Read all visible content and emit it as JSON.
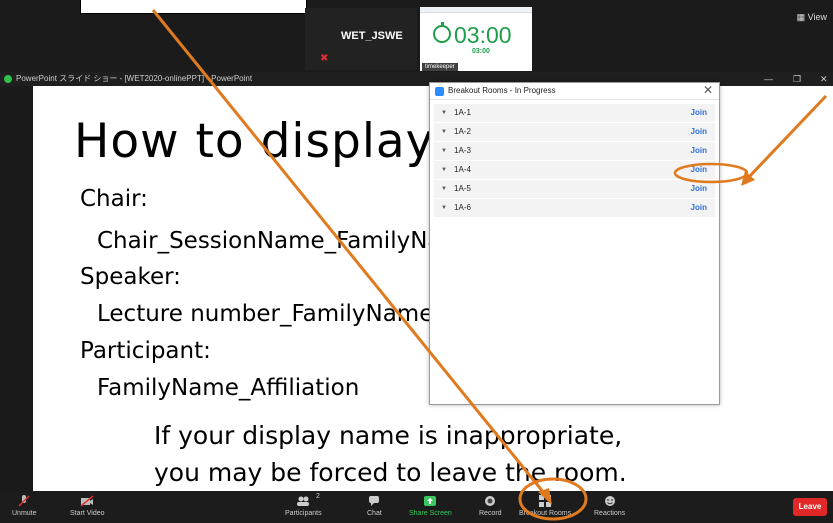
{
  "top": {
    "participant_name": "WET_JSWE",
    "timer_big": "03:00",
    "timer_small": "03:00",
    "timer_label": "timekeeper",
    "view_label": "View"
  },
  "ppt": {
    "window_title": "PowerPoint スライド ショー - [WET2020-onlinePPT] - PowerPoint"
  },
  "slide": {
    "title": "How to display name",
    "lines": [
      "Chair:",
      "Chair_SessionName_FamilyName_Affiliation",
      "Speaker:",
      "Lecture number_FamilyName_Affiliation",
      "Participant:",
      "FamilyName_Affiliation",
      "If your display name is inappropriate,",
      "you may be forced to leave the room."
    ]
  },
  "breakout": {
    "title": "Breakout Rooms - In Progress",
    "rooms": [
      {
        "name": "1A-1",
        "action": "Join"
      },
      {
        "name": "1A-2",
        "action": "Join"
      },
      {
        "name": "1A-3",
        "action": "Join"
      },
      {
        "name": "1A-4",
        "action": "Join"
      },
      {
        "name": "1A-5",
        "action": "Join"
      },
      {
        "name": "1A-6",
        "action": "Join"
      }
    ]
  },
  "toolbar": {
    "unmute": "Unmute",
    "start_video": "Start Video",
    "participants": "Participants",
    "participants_count": "2",
    "chat": "Chat",
    "share_screen": "Share Screen",
    "record": "Record",
    "breakout_rooms": "Breakout Rooms",
    "reactions": "Reactions",
    "leave": "Leave"
  },
  "colors": {
    "timer_green": "#1e9e4a",
    "annotation_orange": "#e07a1f",
    "join_blue": "#2d6fd6",
    "leave_red": "#e02828",
    "share_green": "#38c85f"
  }
}
